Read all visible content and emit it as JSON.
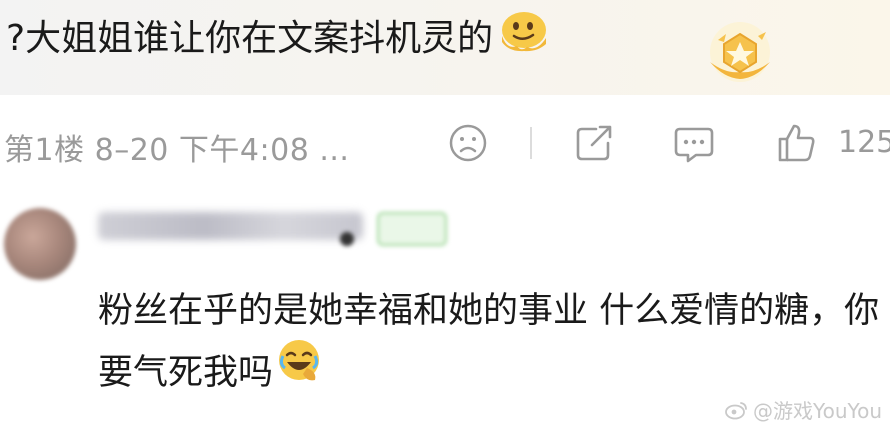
{
  "comment": {
    "text": "?大姐姐谁让你在文案抖机灵的",
    "emoji_icon": "melting-face-icon",
    "badge_icon": "fan-badge-star-icon"
  },
  "meta": {
    "text": "第1楼 8–20 下午4:08 ...",
    "like_count": "125",
    "icons": [
      "dislike-face-icon",
      "share-icon",
      "comment-icon",
      "like-icon"
    ]
  },
  "reply": {
    "text": "粉丝在乎的是她幸福和她的事业  什么爱情的糖，你要气死我吗",
    "emoji_icon": "laughing-crying-face-icon"
  },
  "watermark": {
    "text": "@游戏YouYou"
  },
  "colors": {
    "meta_gray": "#9a9a9a",
    "text": "#1a1a1a",
    "badge_gold": "#f3b53c"
  }
}
